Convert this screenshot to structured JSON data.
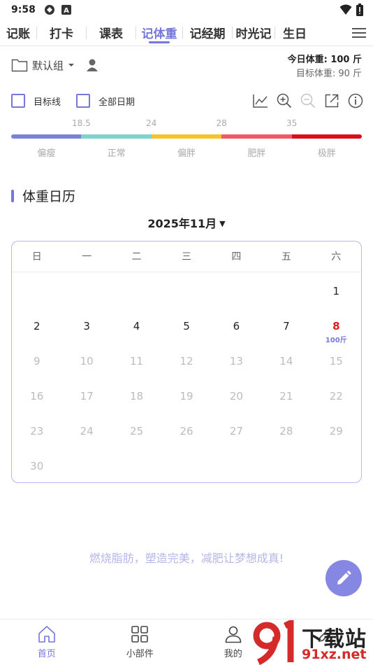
{
  "status_bar": {
    "time": "9:58"
  },
  "tabs": [
    {
      "label": "记账",
      "active": false
    },
    {
      "label": "打卡",
      "active": false
    },
    {
      "label": "课表",
      "active": false
    },
    {
      "label": "记体重",
      "active": true
    },
    {
      "label": "记经期",
      "active": false
    },
    {
      "label": "时光记",
      "active": false
    },
    {
      "label": "生日",
      "active": false
    }
  ],
  "group": {
    "label": "默认组"
  },
  "weights": {
    "today": "今日体重: 100 斤",
    "target": "目标体重: 90 斤"
  },
  "options": {
    "target_line": "目标线",
    "all_dates": "全部日期"
  },
  "bmi": {
    "ticks": [
      "18.5",
      "24",
      "28",
      "35"
    ],
    "categories": [
      "偏瘦",
      "正常",
      "偏胖",
      "肥胖",
      "极胖"
    ],
    "colors": [
      "#7b82d6",
      "#7fd3cf",
      "#f5c32a",
      "#ef5a6a",
      "#d7101d"
    ]
  },
  "calendar": {
    "title": "体重日历",
    "month": "2025年11月",
    "weekdays": [
      "日",
      "一",
      "二",
      "三",
      "四",
      "五",
      "六"
    ],
    "leading_blanks": 6,
    "days": 30,
    "today": 8,
    "today_weight": "100斤",
    "accent": "#7577d9",
    "today_color": "#d81e1e"
  },
  "slogan": "燃烧脂肪，塑造完美，减肥让梦想成真!",
  "bottom_nav": [
    {
      "label": "首页",
      "icon": "home-icon",
      "active": true
    },
    {
      "label": "小部件",
      "icon": "widgets-icon",
      "active": false
    },
    {
      "label": "我的",
      "icon": "profile-icon",
      "active": false
    },
    {
      "label": "",
      "icon": "edit-icon",
      "active": false
    }
  ],
  "watermark": {
    "text": "下载站",
    "sub": "91xz.net"
  }
}
